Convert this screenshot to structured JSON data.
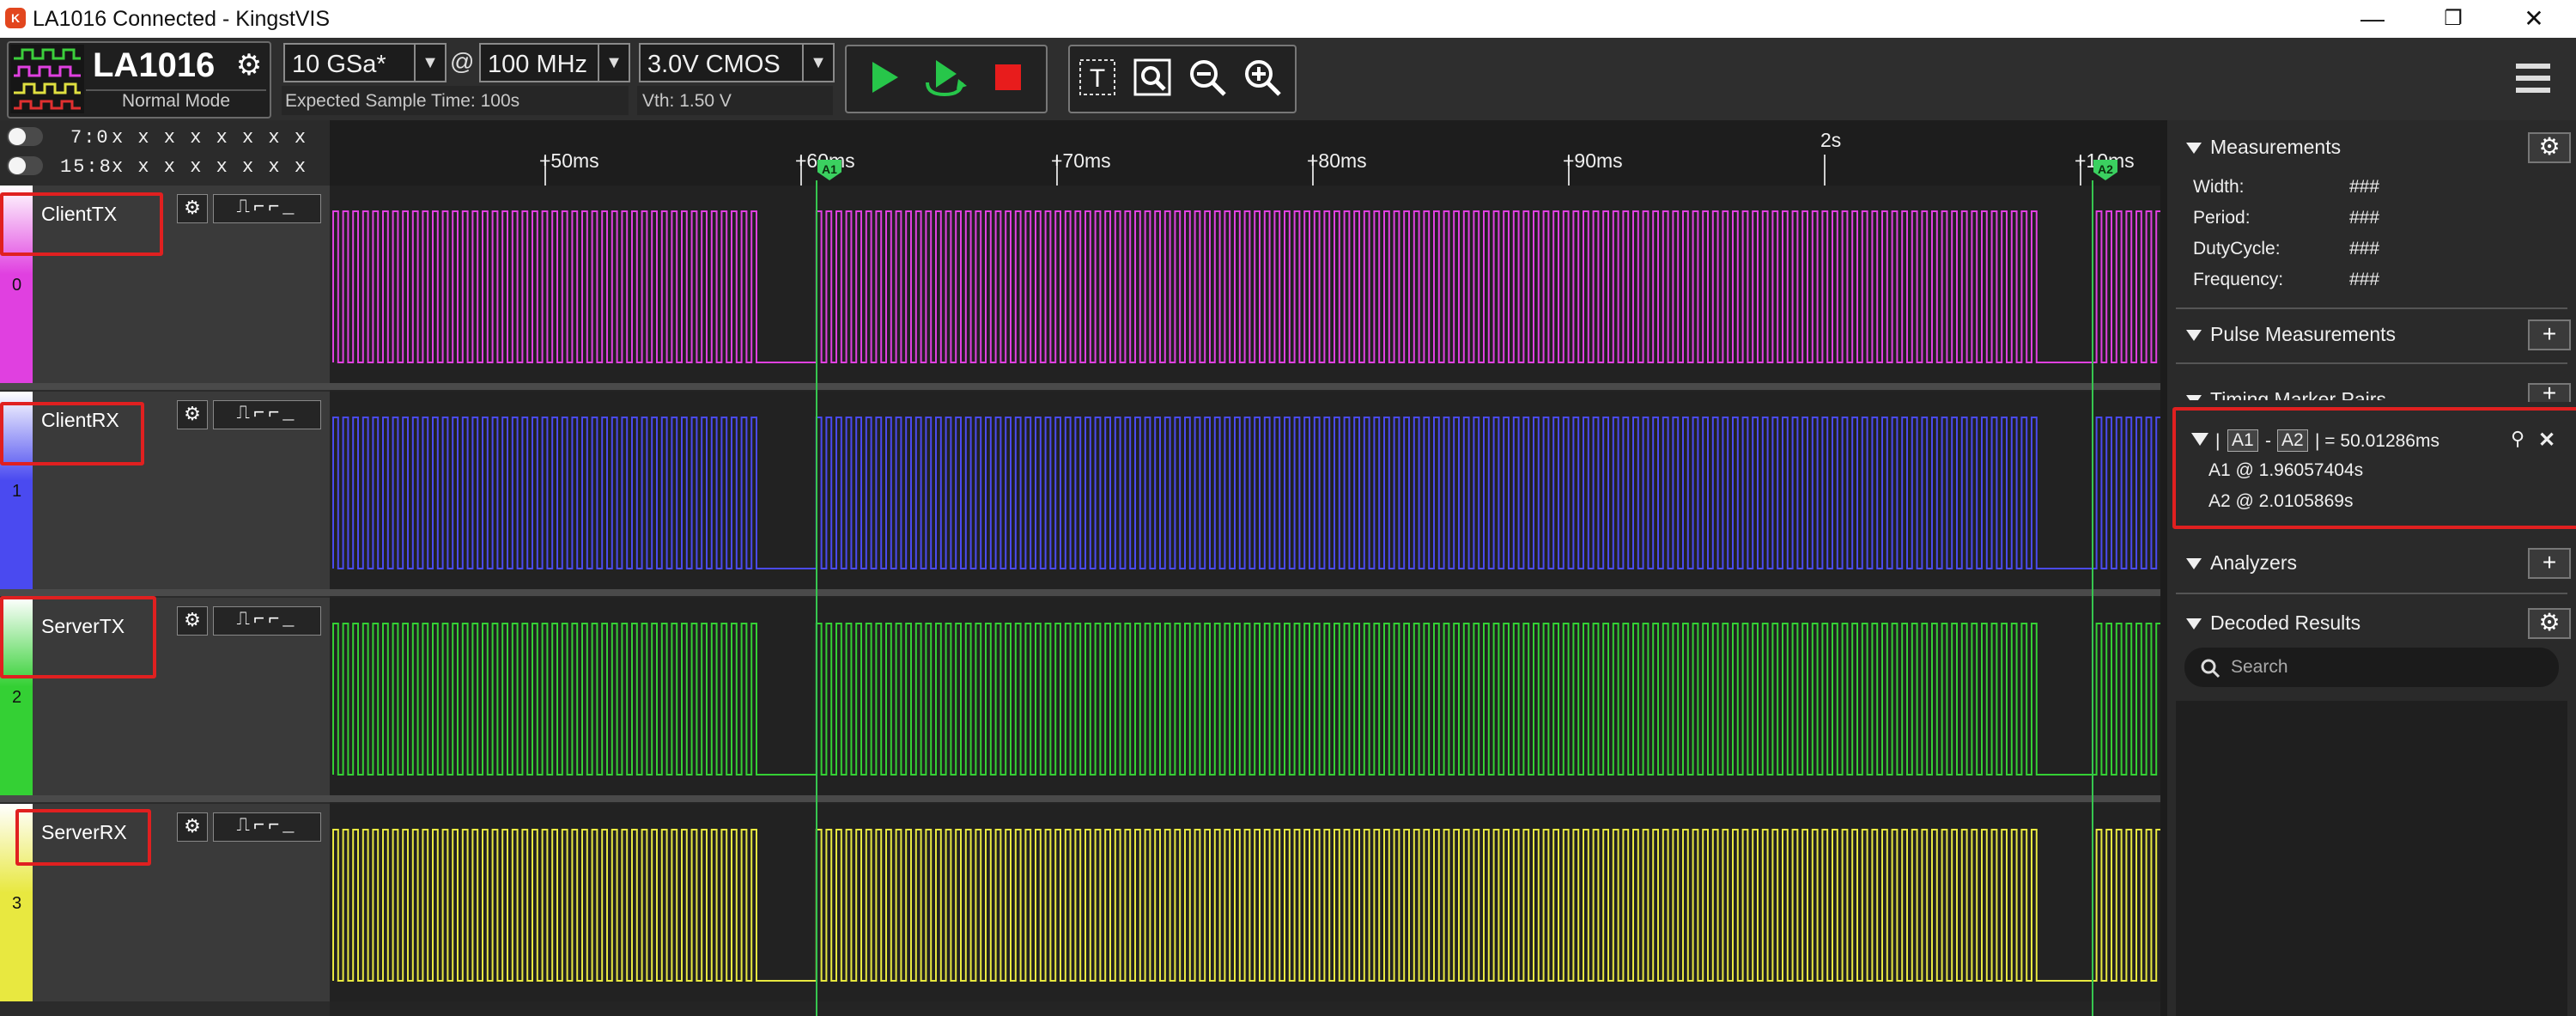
{
  "window": {
    "title": "LA1016 Connected - KingstVIS",
    "minimize": "—",
    "maximize": "❐",
    "close": "✕"
  },
  "toolbar": {
    "device_name": "LA1016",
    "device_mode": "Normal Mode",
    "sample_rate": "10 GSa*",
    "at_sign": "@",
    "sample_freq": "100 MHz",
    "expected_time": "Expected Sample Time: 100s",
    "logic_level": "3.0V CMOS",
    "vth": "Vth:  1.50 V"
  },
  "bits": {
    "row1_label": "7:0",
    "row1_values": "x x x x x x x x",
    "row2_label": "15:8",
    "row2_values": "x x x x x x x x"
  },
  "ruler": {
    "ticks": [
      "+50ms",
      "+60ms",
      "+70ms",
      "+80ms",
      "+90ms",
      "2s",
      "+10ms"
    ],
    "marker_a1": "A1",
    "marker_a2": "A2"
  },
  "channels": [
    {
      "index": "0",
      "name": "ClientTX",
      "color": "#e040e0"
    },
    {
      "index": "1",
      "name": "ClientRX",
      "color": "#4a4af0"
    },
    {
      "index": "2",
      "name": "ServerTX",
      "color": "#34d034"
    },
    {
      "index": "3",
      "name": "ServerRX",
      "color": "#e8e840"
    }
  ],
  "panel": {
    "measurements_title": "Measurements",
    "width_label": "Width:",
    "width_value": "###",
    "period_label": "Period:",
    "period_value": "###",
    "duty_label": "DutyCycle:",
    "duty_value": "###",
    "freq_label": "Frequency:",
    "freq_value": "###",
    "pulse_title": "Pulse Measurements",
    "timing_title": "Timing Marker Pairs",
    "pair_a1": "A1",
    "pair_dash": "-",
    "pair_a2": "A2",
    "pair_result": "| = 50.01286ms",
    "a1_time": "A1 @ 1.96057404s",
    "a2_time": "A2 @ 2.0105869s",
    "analyzers_title": "Analyzers",
    "decoded_title": "Decoded Results",
    "search_placeholder": "Search"
  }
}
